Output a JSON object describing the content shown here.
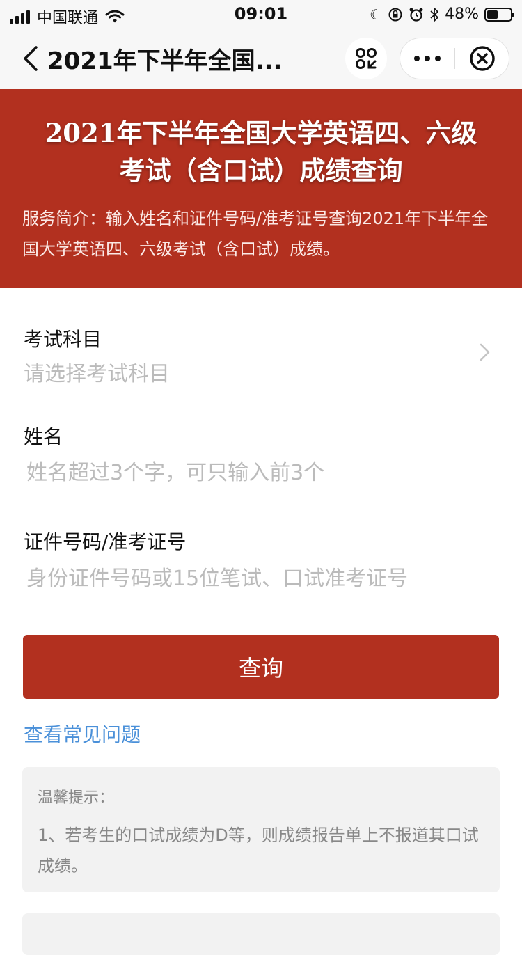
{
  "status_bar": {
    "carrier": "中国联通",
    "time": "09:01",
    "battery_percent": "48%",
    "battery_level": 0.48,
    "icons": [
      "signal-icon",
      "wifi-icon",
      "moon-icon",
      "lock-rotation-icon",
      "alarm-icon",
      "bluetooth-icon",
      "battery-icon"
    ]
  },
  "nav": {
    "title": "2021年下半年全国...",
    "icons": [
      "back-icon",
      "scan-icon",
      "more-icon",
      "close-icon"
    ]
  },
  "banner": {
    "title_line1": "2021年下半年全国大学英语四、六级",
    "title_line2": "考试（含口试）成绩查询",
    "intro": "服务简介：输入姓名和证件号码/准考证号查询2021年下半年全国大学英语四、六级考试（含口试）成绩。",
    "color": "#b2301f"
  },
  "form": {
    "subject": {
      "label": "考试科目",
      "placeholder": "请选择考试科目"
    },
    "name": {
      "label": "姓名",
      "placeholder": "姓名超过3个字，可只输入前3个"
    },
    "id": {
      "label": "证件号码/准考证号",
      "placeholder": "身份证件号码或15位笔试、口试准考证号"
    },
    "submit_label": "查询"
  },
  "faq_link": "查看常见问题",
  "tips": {
    "title": "温馨提示：",
    "body": "1、若考生的口试成绩为D等，则成绩报告单上不报道其口试成绩。"
  },
  "colors": {
    "accent": "#b2301f",
    "link": "#4a90d9",
    "placeholder": "#bbbbbb"
  }
}
